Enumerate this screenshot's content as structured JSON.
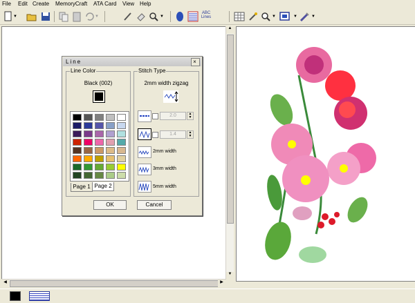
{
  "menu": [
    "File",
    "Edit",
    "Create",
    "MemoryCraft",
    "ATA Card",
    "View",
    "Help"
  ],
  "toolbar_icons": [
    "new-icon",
    "open-icon",
    "save-icon",
    "copy-icon",
    "paste-icon",
    "undo-icon",
    "pen-icon",
    "eraser-icon",
    "zoom-icon",
    "color-icon",
    "fill-pattern-icon",
    "text-lines-icon",
    "grid-icon",
    "select-magic-icon",
    "zoom-tool-icon",
    "preview-icon",
    "stitch-icon"
  ],
  "toolbar_text_icon": "ABC\nLines",
  "dialog": {
    "title": "Line",
    "line_color_label": "Line Color",
    "selected_color": "Black (002)",
    "stitch_type_label": "Stitch Type",
    "stitch_type_value": "2mm width zigzag",
    "spin1_value": "2.0",
    "spin2_value": "1.4",
    "stitch_options": [
      "2mm width",
      "3mm width",
      "5mm width"
    ],
    "tabs": [
      "Page 1",
      "Page 2"
    ],
    "ok_label": "OK",
    "cancel_label": "Cancel",
    "palette": [
      [
        "#000000",
        "#555555",
        "#808080",
        "#c0c0c0",
        "#ffffff"
      ],
      [
        "#1a1a66",
        "#2b3a99",
        "#5555aa",
        "#88a0c8",
        "#c8d8f0"
      ],
      [
        "#3a1a5a",
        "#7a3a8a",
        "#aa66aa",
        "#b0a0d0",
        "#b0e0e0"
      ],
      [
        "#cc2200",
        "#ee0066",
        "#ee66aa",
        "#e0a0b0",
        "#55aaaa"
      ],
      [
        "#553322",
        "#996644",
        "#cc9966",
        "#ddbb88",
        "#d8b890"
      ],
      [
        "#ff6600",
        "#ffaa00",
        "#c0a000",
        "#e6c070",
        "#e0d0a0"
      ],
      [
        "#1a6a2a",
        "#339933",
        "#66aa33",
        "#99cc33",
        "#ffff00"
      ],
      [
        "#224422",
        "#446633",
        "#668844",
        "#aacc88",
        "#ccddaa"
      ]
    ]
  },
  "statusbar": {
    "color_swatch": "#000000"
  }
}
